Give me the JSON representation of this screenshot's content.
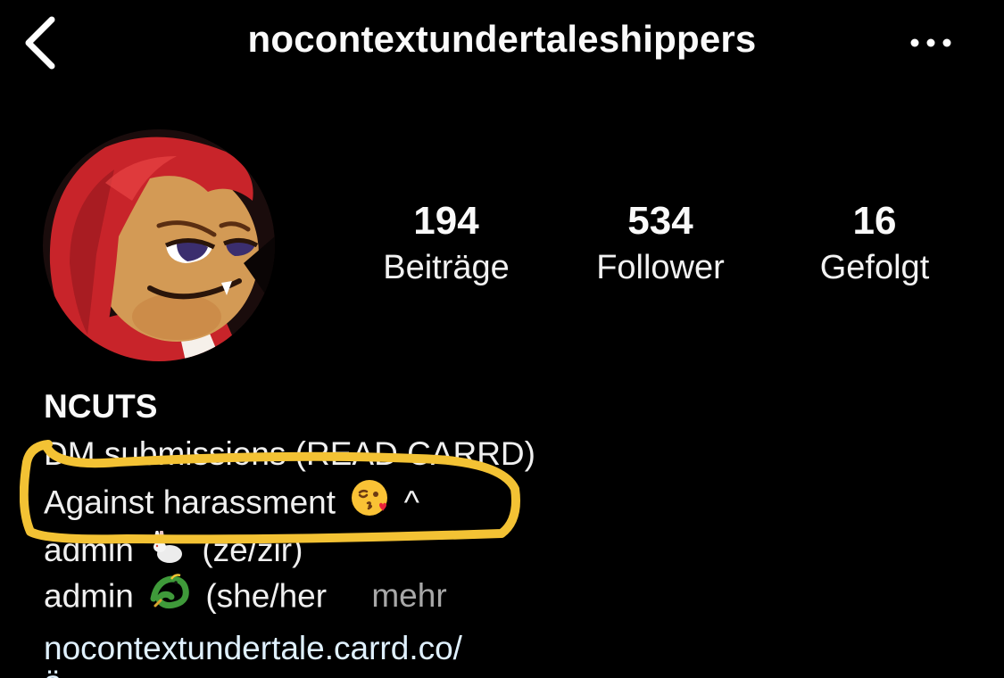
{
  "header": {
    "username": "nocontextundertaleshippers",
    "back_icon": "chevron-left-icon",
    "more_icon": "more-horizontal-icon"
  },
  "profile": {
    "avatar_icon": "profile-avatar",
    "stats": [
      {
        "value": "194",
        "label": "Beiträge"
      },
      {
        "value": "534",
        "label": "Follower"
      },
      {
        "value": "16",
        "label": "Gefolgt"
      }
    ]
  },
  "bio": {
    "name": "NCUTS",
    "line1": "DM submissions (READ CARRD)",
    "line2_text": "Against harassment",
    "line2_suffix": "^",
    "line3_prefix": "admin",
    "line3_suffix": "(ze/zir)",
    "line4_prefix": "admin",
    "line4_suffix": "(she/her",
    "more": "mehr",
    "link": "nocontextundertale.carrd.co/",
    "link_cut": "ä"
  },
  "colors": {
    "background": "#000000",
    "text": "#f5f5f5",
    "muted": "#a8a8a8",
    "link": "#e0f1ff",
    "highlight": "#f3c234"
  }
}
